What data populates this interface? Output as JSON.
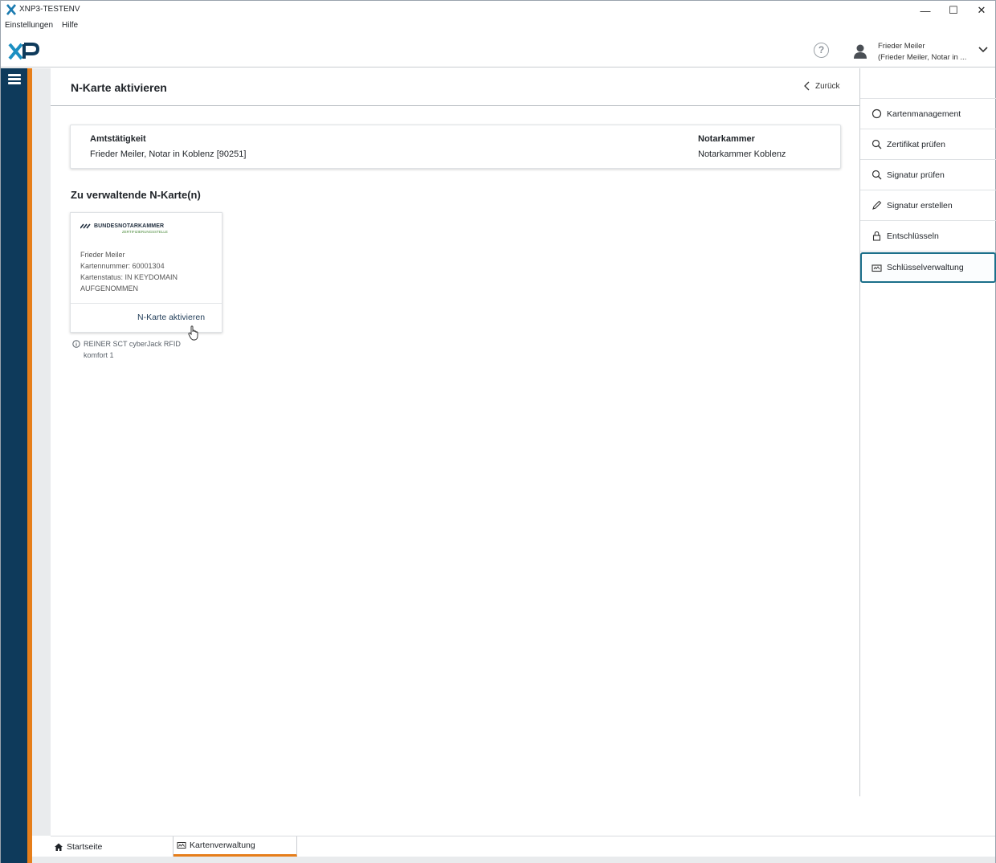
{
  "window": {
    "title": "XNP3-TESTENV",
    "controls": {
      "minimize": "—",
      "maximize": "☐",
      "close": "✕"
    }
  },
  "menubar": {
    "items": [
      "Einstellungen",
      "Hilfe"
    ]
  },
  "header": {
    "logo_text": "XP",
    "help_glyph": "?",
    "user_name": "Frieder Meiler",
    "user_sub": "(Frieder Meiler, Notar in ..."
  },
  "page": {
    "title": "N-Karte aktivieren",
    "back_label": "Zurück"
  },
  "info": {
    "amt_label": "Amtstätigkeit",
    "amt_value": "Frieder Meiler, Notar in Koblenz [90251]",
    "kammer_label": "Notarkammer",
    "kammer_value": "Notarkammer Koblenz"
  },
  "cards_section": {
    "title": "Zu verwaltende N-Karte(n)",
    "card": {
      "brand": "BUNDESNOTARKAMMER",
      "brand_sub": "ZERTIFIZIERUNGSSTELLE",
      "holder": "Frieder Meiler",
      "number": "Kartennummer: 60001304",
      "status_line1": "Kartenstatus: IN KEYDOMAIN",
      "status_line2": "AUFGENOMMEN",
      "action": "N-Karte aktivieren"
    },
    "reader_line1": "REINER SCT cyberJack RFID",
    "reader_line2": "komfort 1"
  },
  "right_nav": {
    "items": [
      {
        "label": "Kartenmanagement",
        "icon": "circle-icon"
      },
      {
        "label": "Zertifikat prüfen",
        "icon": "search-icon"
      },
      {
        "label": "Signatur prüfen",
        "icon": "search-icon"
      },
      {
        "label": "Signatur erstellen",
        "icon": "pen-icon"
      },
      {
        "label": "Entschlüsseln",
        "icon": "lock-icon"
      },
      {
        "label": "Schlüsselverwaltung",
        "icon": "card-icon",
        "active": true
      }
    ]
  },
  "tabs": [
    {
      "label": "Startseite",
      "icon": "home-icon"
    },
    {
      "label": "Kartenverwaltung",
      "icon": "card-icon",
      "active": true
    }
  ],
  "colors": {
    "rail": "#0e3a5b",
    "accent_orange": "#e67e1a",
    "active_border": "#1b6f8a"
  }
}
